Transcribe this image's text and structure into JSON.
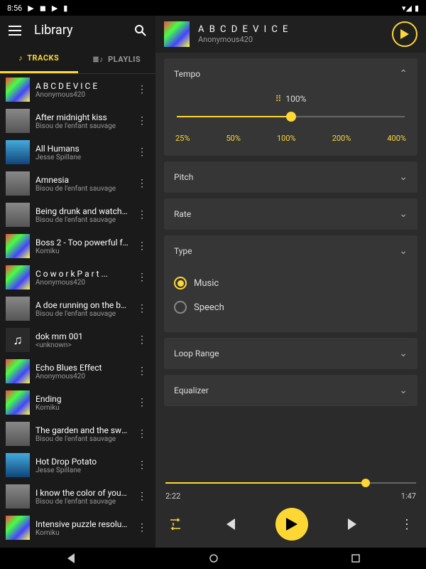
{
  "status": {
    "time": "8:56"
  },
  "sidebar": {
    "title": "Library",
    "tabs": {
      "tracks": "TRACKS",
      "playlist": "PLAYLIS"
    }
  },
  "tracks": [
    {
      "title": "A B C D E V I C E",
      "artist": "Anonymous420",
      "thumb": "rainbow"
    },
    {
      "title": "After midnight kiss",
      "artist": "Bisou de l'enfant sauvage",
      "thumb": "gray"
    },
    {
      "title": "All Humans",
      "artist": "Jesse Spillane",
      "thumb": "blue"
    },
    {
      "title": "Amnesia",
      "artist": "Bisou de l'enfant sauvage",
      "thumb": "gray"
    },
    {
      "title": "Being drunk and watchi...",
      "artist": "Bisou de l'enfant sauvage",
      "thumb": "gray"
    },
    {
      "title": "Boss 2 - Too powerful f...",
      "artist": "Komiku",
      "thumb": "rainbow"
    },
    {
      "title": "C o w o r k  P a r t ...",
      "artist": "Anonymous420",
      "thumb": "rainbow"
    },
    {
      "title": "A doe running on the be...",
      "artist": "Bisou de l'enfant sauvage",
      "thumb": "gray"
    },
    {
      "title": "dok mm 001",
      "artist": "<unknown>",
      "thumb": "dark"
    },
    {
      "title": "Echo Blues Effect",
      "artist": "Anonymous420",
      "thumb": "rainbow"
    },
    {
      "title": "Ending",
      "artist": "Komiku",
      "thumb": "rainbow"
    },
    {
      "title": "The garden and the swing",
      "artist": "Bisou de l'enfant sauvage",
      "thumb": "gray"
    },
    {
      "title": "Hot Drop Potato",
      "artist": "Jesse Spillane",
      "thumb": "blue"
    },
    {
      "title": "I know the color of your ...",
      "artist": "Bisou de l'enfant sauvage",
      "thumb": "gray"
    },
    {
      "title": "Intensive puzzle resoluti...",
      "artist": "Komiku",
      "thumb": "rainbow"
    }
  ],
  "now_playing": {
    "title": "A B C D E V I C E",
    "artist": "Anonymous420"
  },
  "tempo": {
    "label": "Tempo",
    "value": "100%",
    "percent": 50,
    "marks": [
      "25%",
      "50%",
      "100%",
      "200%",
      "400%"
    ]
  },
  "panels": {
    "pitch": "Pitch",
    "rate": "Rate",
    "type": "Type",
    "loop": "Loop Range",
    "eq": "Equalizer"
  },
  "type_options": {
    "music": "Music",
    "speech": "Speech",
    "selected": "music"
  },
  "player": {
    "elapsed": "2:22",
    "total": "1:47",
    "progress_percent": 80
  }
}
